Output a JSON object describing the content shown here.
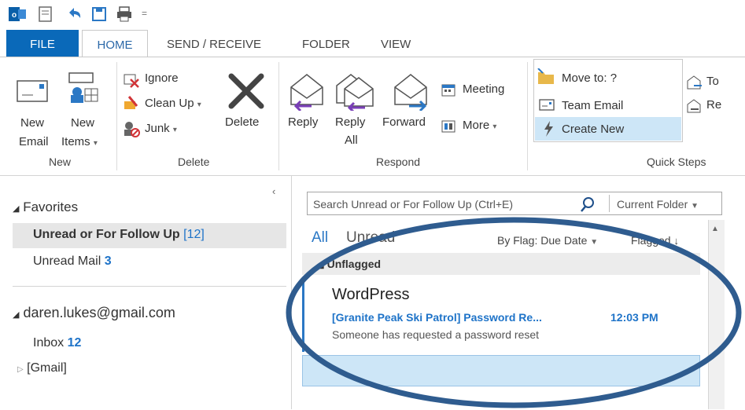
{
  "ribbon_tabs": [
    "FILE",
    "HOME",
    "SEND / RECEIVE",
    "FOLDER",
    "VIEW"
  ],
  "ribbon": {
    "new_email": [
      "New",
      "Email"
    ],
    "new_items": [
      "New",
      "Items"
    ],
    "group_new": "New",
    "ignore": "Ignore",
    "clean_up": "Clean Up",
    "junk": "Junk",
    "delete": "Delete",
    "group_delete": "Delete",
    "reply": "Reply",
    "reply_all": [
      "Reply",
      "All"
    ],
    "forward": "Forward",
    "meeting": "Meeting",
    "more": "More",
    "group_respond": "Respond",
    "move_to": "Move to: ?",
    "team_email": "Team Email",
    "create_new": "Create New",
    "to_partial": "To",
    "re_partial": "Re",
    "group_quick_steps": "Quick Steps"
  },
  "folders": {
    "favorites": "Favorites",
    "unread_followup": "Unread or For Follow Up",
    "unread_followup_count": "[12]",
    "unread_mail": "Unread Mail",
    "unread_mail_count": "3",
    "account": "daren.lukes@gmail.com",
    "inbox": "Inbox",
    "inbox_count": "12",
    "gmail": "[Gmail]"
  },
  "search": {
    "placeholder": "Search Unread or For Follow Up (Ctrl+E)",
    "scope": "Current Folder"
  },
  "list": {
    "filter_all": "All",
    "filter_unread": "Unread",
    "sort": "By Flag: Due Date",
    "flagged": "Flagged",
    "group": "Unflagged",
    "message": {
      "sender": "WordPress",
      "subject": "[Granite Peak Ski Patrol] Password Re...",
      "time": "12:03 PM",
      "preview": "Someone has requested a password reset"
    }
  },
  "colors": {
    "accent": "#0a69b9",
    "link": "#1e73c8",
    "annotation": "#2f5c8f"
  }
}
